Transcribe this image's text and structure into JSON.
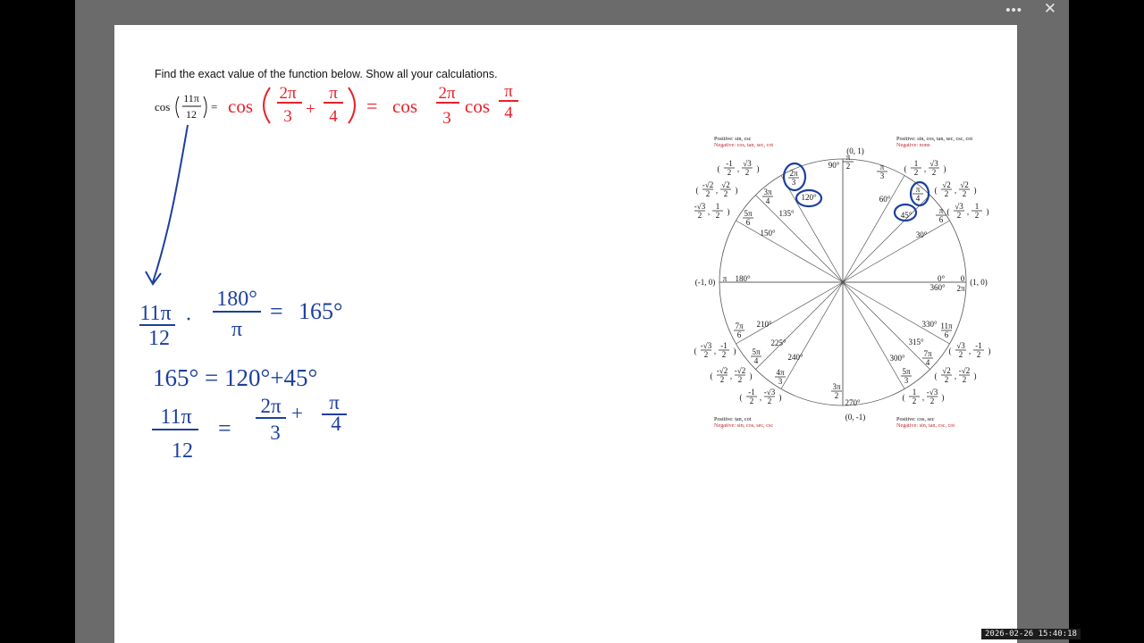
{
  "viewer": {
    "more_label": "•••",
    "close_label": "✕",
    "timestamp": "2026-02-26 15:40:18"
  },
  "worksheet": {
    "instruction": "Find the exact value of the function below. Show all your calculations.",
    "problem": {
      "func": "cos",
      "num": "11π",
      "den": "12",
      "eq": "="
    }
  },
  "handwriting": {
    "colors": {
      "red": "#e8212a",
      "blue": "#1d3f9e"
    },
    "step1": {
      "cos_a": "cos",
      "a_num": "2π",
      "a_den": "3",
      "plus": "+",
      "b_num": "π",
      "b_den": "4",
      "eq": "=",
      "cos_b": "cos",
      "c_num": "2π",
      "c_den": "3",
      "cos_c": "cos",
      "d_num": "π",
      "d_den": "4"
    },
    "conv": {
      "n": "11π",
      "d": "12",
      "dot": "·",
      "cn": "180°",
      "cd": "π",
      "eq": "=",
      "res": "165°"
    },
    "split": {
      "text": "165° = 120°+45°"
    },
    "rad": {
      "n": "11π",
      "d": "12",
      "eq": "=",
      "an": "2π",
      "ad": "3",
      "plus": "+",
      "bn": "π",
      "bd": "4"
    }
  },
  "unit_circle": {
    "quadrant_notes": {
      "q2_pos": "Positive: sin, csc",
      "q2_neg": "Negative: cos, tan, sec, cot",
      "q1_pos": "Positive: sin, cos, tan, sec, csc, cot",
      "q1_neg": "Negative: none",
      "q3_pos": "Positive: tan, cot",
      "q3_neg": "Negative: sin, cos, sec, csc",
      "q4_pos": "Positive: cos, sec",
      "q4_neg": "Negative: sin, tan, csc, cot"
    },
    "axis_points": {
      "top": "(0, 1)",
      "bottom": "(0, -1)",
      "left": "(-1, 0)",
      "right": "(1, 0)"
    },
    "degrees": [
      "0°",
      "30°",
      "45°",
      "60°",
      "90°",
      "120°",
      "135°",
      "150°",
      "180°",
      "210°",
      "225°",
      "240°",
      "270°",
      "300°",
      "315°",
      "330°",
      "360°"
    ],
    "radians": {
      "r0": "0",
      "r30": [
        "π",
        "6"
      ],
      "r45": [
        "π",
        "4"
      ],
      "r60": [
        "π",
        "3"
      ],
      "r90": [
        "π",
        "2"
      ],
      "r120": [
        "2π",
        "3"
      ],
      "r135": [
        "3π",
        "4"
      ],
      "r150": [
        "5π",
        "6"
      ],
      "r180": "π",
      "r210": [
        "7π",
        "6"
      ],
      "r225": [
        "5π",
        "4"
      ],
      "r240": [
        "4π",
        "3"
      ],
      "r270": [
        "3π",
        "2"
      ],
      "r300": [
        "5π",
        "3"
      ],
      "r315": [
        "7π",
        "4"
      ],
      "r330": [
        "11π",
        "6"
      ],
      "r360": "2π"
    },
    "coords": {
      "c30": [
        "√3",
        "2",
        "1",
        "2"
      ],
      "c45": [
        "√2",
        "2",
        "√2",
        "2"
      ],
      "c60": [
        "1",
        "2",
        "√3",
        "2"
      ],
      "c120": [
        "1",
        "2",
        "√3",
        "2"
      ],
      "c135": [
        "√2",
        "2",
        "√2",
        "2"
      ],
      "c150": [
        "-√3",
        "2",
        "1",
        "2"
      ],
      "c210": [
        "-√3",
        "2",
        "-1",
        "2"
      ],
      "c225": [
        "√2",
        "2",
        "-√2",
        "2"
      ],
      "c240": [
        "-1",
        "2",
        "-√3",
        "2"
      ],
      "c300": [
        "1",
        "2",
        "-√3",
        "2"
      ],
      "c315": [
        "√2",
        "2",
        "-√2",
        "2"
      ],
      "c330": [
        "√3",
        "2",
        "-1",
        "2"
      ]
    },
    "prefix": {
      "c120": "-",
      "c135": "-",
      "c225": "-"
    }
  }
}
